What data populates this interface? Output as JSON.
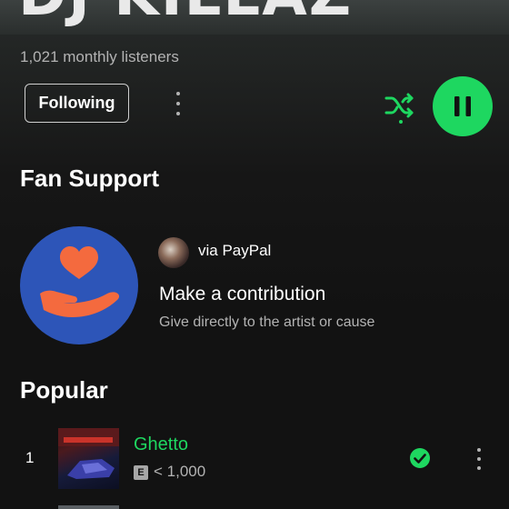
{
  "artist": {
    "name": "DJ KILLAZ",
    "monthly_listeners": "1,021 monthly listeners"
  },
  "actions": {
    "follow_label": "Following",
    "more_icon": "more-vertical-icon",
    "shuffle_icon": "shuffle-icon",
    "play_icon": "pause-icon",
    "accent_color": "#1ed760"
  },
  "fan_support": {
    "section_title": "Fan Support",
    "via": "via PayPal",
    "title": "Make a contribution",
    "subtitle": "Give directly to the artist or cause",
    "art_color": "#2d55b8",
    "art_icon": "heart-in-hand-icon"
  },
  "popular": {
    "section_title": "Popular",
    "tracks": [
      {
        "rank": "1",
        "title": "Ghetto",
        "explicit": "E",
        "plays": "< 1,000",
        "saved": true
      }
    ]
  }
}
